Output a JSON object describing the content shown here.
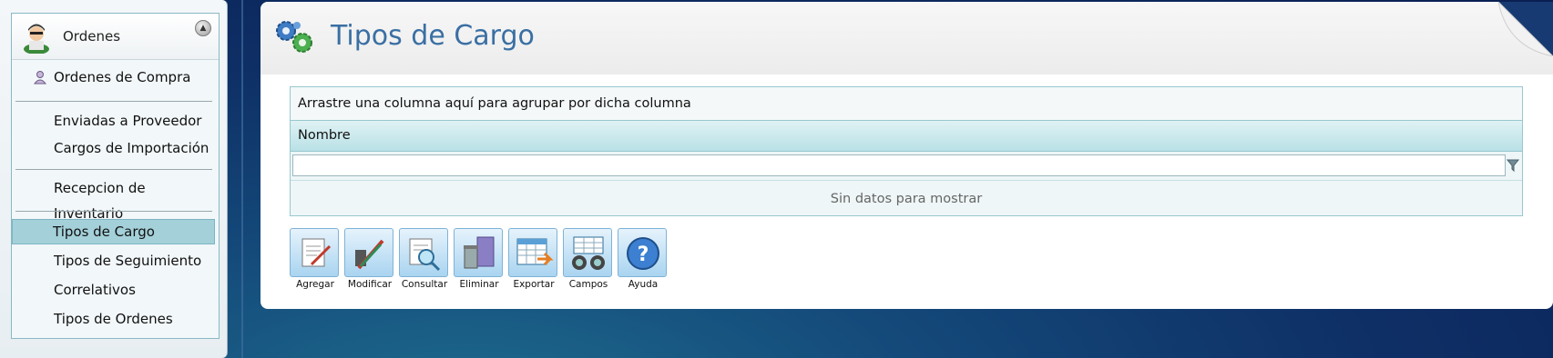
{
  "sidebar": {
    "title": "Ordenes",
    "items": [
      {
        "label": "Ordenes de Compra"
      },
      {
        "label": "Enviadas a Proveedor"
      },
      {
        "label": "Cargos de Importación"
      },
      {
        "label": "Recepcion de Inventario"
      },
      {
        "label": "Tipos de Cargo",
        "active": true
      },
      {
        "label": "Tipos de Seguimiento"
      },
      {
        "label": "Correlativos"
      },
      {
        "label": "Tipos de Ordenes"
      }
    ]
  },
  "header": {
    "title": "Tipos de Cargo"
  },
  "grid": {
    "group_hint": "Arrastre una columna aquí para agrupar por dicha columna",
    "columns": [
      "Nombre"
    ],
    "filter_value": "",
    "empty_text": "Sin datos para mostrar"
  },
  "toolbar": {
    "buttons": [
      {
        "label": "Agregar",
        "icon": "add-document-icon"
      },
      {
        "label": "Modificar",
        "icon": "edit-pencils-icon"
      },
      {
        "label": "Consultar",
        "icon": "search-document-icon"
      },
      {
        "label": "Eliminar",
        "icon": "trash-icon"
      },
      {
        "label": "Exportar",
        "icon": "export-spreadsheet-icon"
      },
      {
        "label": "Campos",
        "icon": "binoculars-icon"
      },
      {
        "label": "Ayuda",
        "icon": "help-icon"
      }
    ]
  },
  "colors": {
    "accent": "#3a6fa3",
    "selected": "#a4d0d9",
    "grid_border": "#98c8cf"
  }
}
